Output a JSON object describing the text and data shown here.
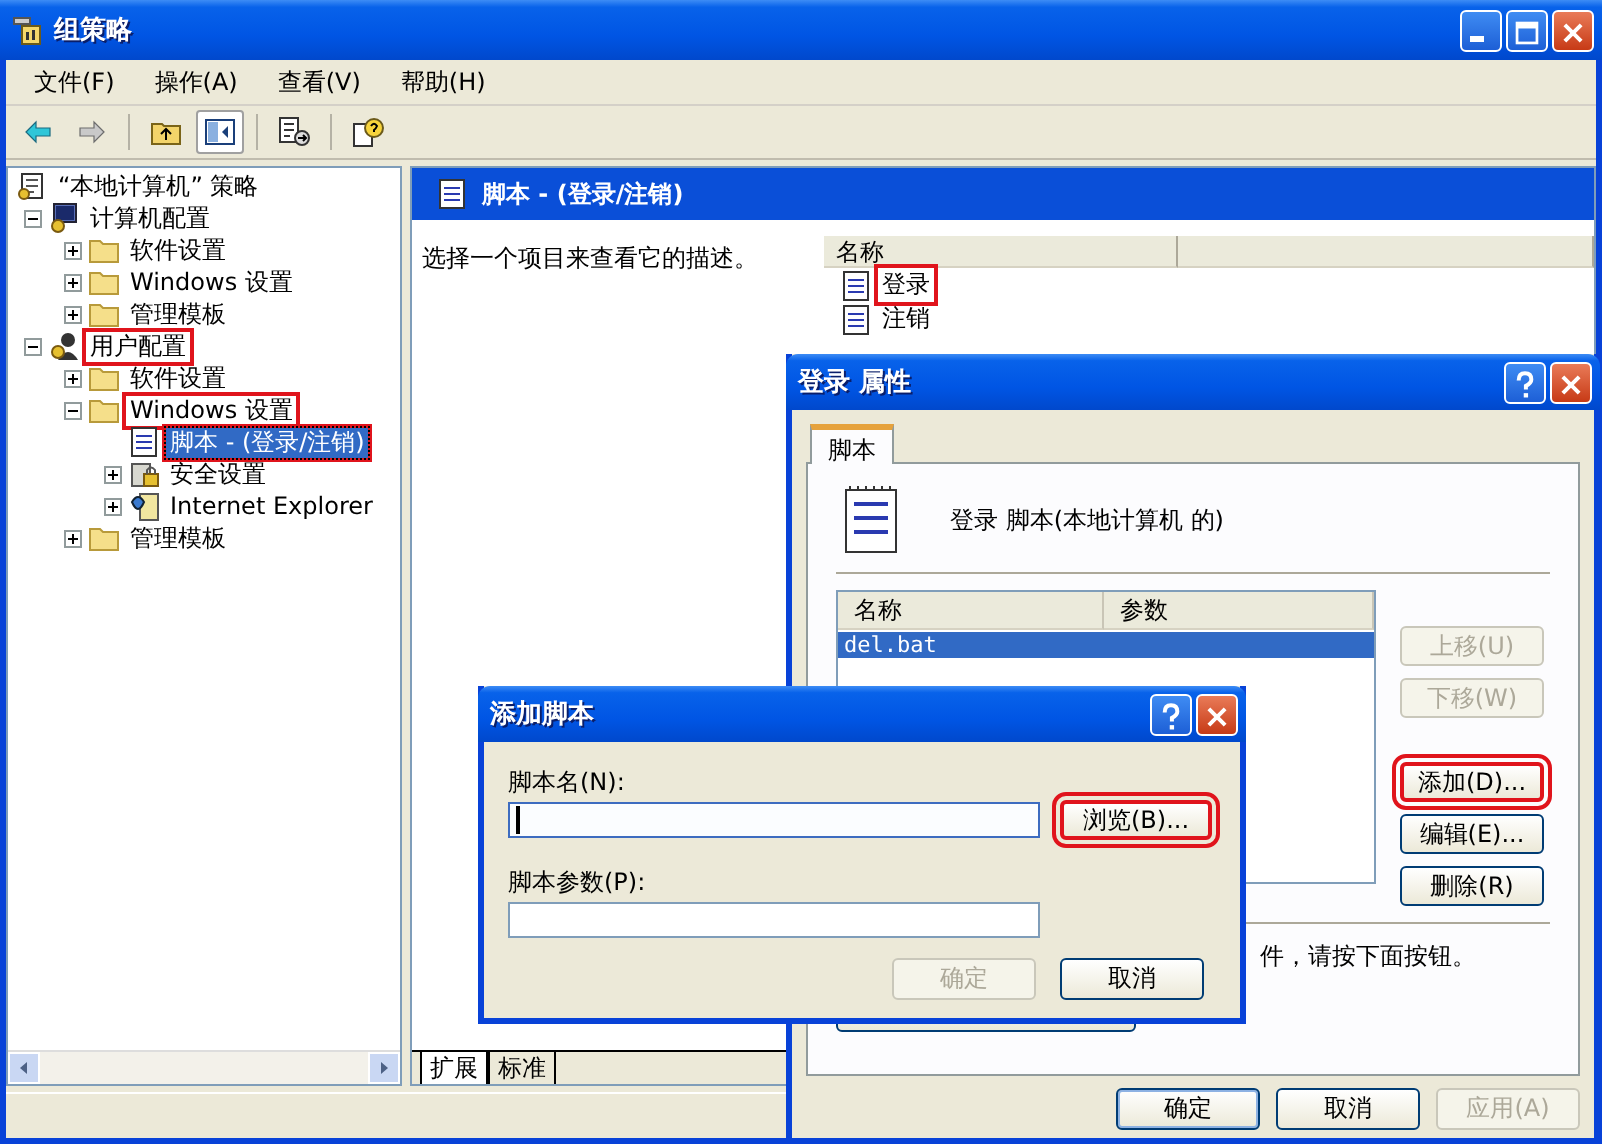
{
  "window": {
    "title": "组策略"
  },
  "menu": [
    {
      "label": "文件(F)"
    },
    {
      "label": "操作(A)"
    },
    {
      "label": "查看(V)"
    },
    {
      "label": "帮助(H)"
    }
  ],
  "toolbar": [
    {
      "kind": "back",
      "disabled": false,
      "pressed": false
    },
    {
      "kind": "forward",
      "disabled": true,
      "pressed": false
    },
    {
      "kind": "up",
      "disabled": false,
      "pressed": false
    },
    {
      "kind": "tree",
      "disabled": false,
      "pressed": true
    },
    {
      "kind": "export",
      "disabled": false,
      "pressed": false
    },
    {
      "kind": "help",
      "disabled": false,
      "pressed": false
    }
  ],
  "tree": [
    {
      "label": "“本地计算机” 策略",
      "kind": "policy",
      "selected": false,
      "highlighted": false,
      "children": [
        {
          "label": "计算机配置",
          "kind": "computer",
          "expanded": true,
          "selected": false,
          "highlighted": false,
          "children": [
            {
              "label": "软件设置",
              "kind": "folder",
              "expanded": false,
              "selected": false,
              "highlighted": false
            },
            {
              "label": "Windows 设置",
              "kind": "folder",
              "expanded": false,
              "selected": false,
              "highlighted": false
            },
            {
              "label": "管理模板",
              "kind": "folder",
              "expanded": false,
              "selected": false,
              "highlighted": false
            }
          ]
        },
        {
          "label": "用户配置",
          "kind": "user",
          "expanded": true,
          "selected": false,
          "highlighted": true,
          "children": [
            {
              "label": "软件设置",
              "kind": "folder",
              "expanded": false,
              "selected": false,
              "highlighted": false
            },
            {
              "label": "Windows 设置",
              "kind": "folder",
              "expanded": true,
              "selected": false,
              "highlighted": true,
              "children": [
                {
                  "label": "脚本 - (登录/注销)",
                  "kind": "script",
                  "selected": true,
                  "highlighted": true
                },
                {
                  "label": "安全设置",
                  "kind": "security",
                  "expanded": false,
                  "selected": false,
                  "highlighted": false
                },
                {
                  "label": "Internet Explorer",
                  "kind": "browser",
                  "expanded": false,
                  "selected": false,
                  "highlighted": false
                }
              ]
            },
            {
              "label": "管理模板",
              "kind": "folder",
              "expanded": false,
              "selected": false,
              "highlighted": false
            }
          ]
        }
      ]
    }
  ],
  "details": {
    "title": "脚本 - (登录/注销)",
    "description": "选择一个项目来查看它的描述。",
    "columns": [
      {
        "label": "名称"
      }
    ],
    "items": [
      {
        "label": "登录",
        "highlighted": true
      },
      {
        "label": "注销",
        "highlighted": false
      }
    ],
    "view_tabs": [
      {
        "label": "扩展",
        "selected": true
      },
      {
        "label": "标准",
        "selected": false
      }
    ]
  },
  "properties_dialog": {
    "title": "登录 属性",
    "tabs": [
      {
        "label": "脚本",
        "selected": true
      }
    ],
    "heading": "登录 脚本(本地计算机 的)",
    "columns": [
      {
        "label": "名称"
      },
      {
        "label": "参数"
      }
    ],
    "rows": [
      {
        "name": "del.bat",
        "selected": true
      }
    ],
    "side_buttons": [
      {
        "label": "上移(U)",
        "disabled": true,
        "highlighted": false
      },
      {
        "label": "下移(W)",
        "disabled": true,
        "highlighted": false
      },
      {
        "label": "添加(D)...",
        "disabled": false,
        "highlighted": true
      },
      {
        "label": "编辑(E)...",
        "disabled": false,
        "highlighted": false
      },
      {
        "label": "删除(R)",
        "disabled": false,
        "highlighted": false
      }
    ],
    "note": "件，请按下面按钮。",
    "buttons": [
      {
        "label": "确定",
        "disabled": false,
        "default": true
      },
      {
        "label": "取消",
        "disabled": false,
        "default": false
      },
      {
        "label": "应用(A)",
        "disabled": true,
        "default": false
      }
    ]
  },
  "add_dialog": {
    "title": "添加脚本",
    "fields": [
      {
        "label": "脚本名(N):",
        "focused": true
      },
      {
        "label": "脚本参数(P):",
        "focused": false
      }
    ],
    "browse_button": {
      "label": "浏览(B)...",
      "highlighted": true
    },
    "buttons": [
      {
        "label": "确定",
        "disabled": true,
        "default": false
      },
      {
        "label": "取消",
        "disabled": false,
        "default": false
      }
    ]
  }
}
